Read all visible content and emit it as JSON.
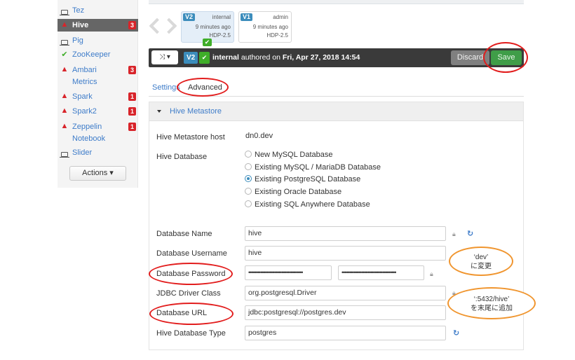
{
  "sidebar": {
    "items": [
      {
        "label": "Tez",
        "icon": "laptop-icon",
        "status": "",
        "badge": ""
      },
      {
        "label": "Hive",
        "icon": "warning-icon",
        "status": "alert",
        "badge": "3"
      },
      {
        "label": "Pig",
        "icon": "laptop-icon",
        "status": "",
        "badge": ""
      },
      {
        "label": "ZooKeeper",
        "icon": "check-circle-icon",
        "status": "ok",
        "badge": ""
      },
      {
        "label": "Ambari",
        "label2": "Metrics",
        "icon": "warning-icon",
        "status": "alert",
        "badge": "3"
      },
      {
        "label": "Spark",
        "icon": "warning-icon",
        "status": "alert",
        "badge": "1"
      },
      {
        "label": "Spark2",
        "icon": "warning-icon",
        "status": "alert",
        "badge": "1"
      },
      {
        "label": "Zeppelin",
        "label2": "Notebook",
        "icon": "warning-icon",
        "status": "alert",
        "badge": "1"
      },
      {
        "label": "Slider",
        "icon": "laptop-icon",
        "status": "",
        "badge": ""
      }
    ],
    "actions_label": "Actions ▾"
  },
  "versions": [
    {
      "tag": "V2",
      "author": "internal",
      "time": "9 minutes ago",
      "stack": "HDP-2.5",
      "current": true
    },
    {
      "tag": "V1",
      "author": "admin",
      "time": "9 minutes ago",
      "stack": "HDP-2.5",
      "current": false
    }
  ],
  "bar": {
    "shuffle_label": "⤨ ▾",
    "version_tag": "V2",
    "author": "internal",
    "text_middle": " authored on ",
    "date": "Fri, Apr 27, 2018 14:54",
    "discard_label": "Discard",
    "save_label": "Save"
  },
  "tabs": {
    "settings": "Settings",
    "advanced": "Advanced"
  },
  "panel": {
    "title": "Hive Metastore",
    "metastore_host_label": "Hive Metastore host",
    "metastore_host_value": "dn0.dev",
    "hive_database_label": "Hive Database",
    "database_options": [
      {
        "label": "New MySQL Database",
        "selected": false
      },
      {
        "label": "Existing MySQL / MariaDB Database",
        "selected": false
      },
      {
        "label": "Existing PostgreSQL Database",
        "selected": true
      },
      {
        "label": "Existing Oracle Database",
        "selected": false
      },
      {
        "label": "Existing SQL Anywhere Database",
        "selected": false
      }
    ],
    "db_name_label": "Database Name",
    "db_name_value": "hive",
    "db_user_label": "Database Username",
    "db_user_value": "hive",
    "db_password_label": "Database Password",
    "db_password_value": "••••••••••••••••••••••••••••••••••••",
    "db_password_confirm_value": "••••••••••••••••••••••••••••••••••••",
    "jdbc_driver_label": "JDBC Driver Class",
    "jdbc_driver_value": "org.postgresql.Driver",
    "db_url_label": "Database URL",
    "db_url_value": "jdbc:postgresql://postgres.dev",
    "db_type_label": "Hive Database Type",
    "db_type_value": "postgres"
  },
  "annotations": {
    "password_note_line1": "‘dev’",
    "password_note_line2": "に変更",
    "url_note_line1": "‘:5432/hive’",
    "url_note_line2": "を末尾に追加"
  },
  "colors": {
    "link_blue": "#3e7cc9",
    "alert_red": "#d8242a",
    "ok_green": "#3fae29",
    "save_green": "#3f9d48",
    "annotation_red": "#e21d1d",
    "callout_orange": "#f0952e",
    "version_blue": "#3c8dbc"
  }
}
